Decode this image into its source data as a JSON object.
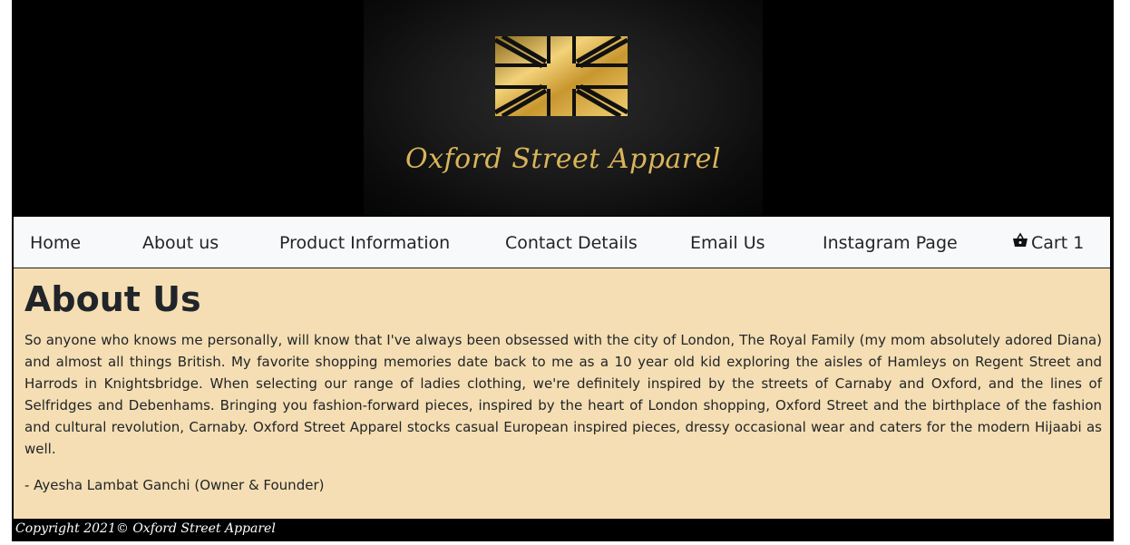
{
  "header": {
    "logo_alt": "Oxford Street Apparel",
    "brand_name": "Oxford Street Apparel"
  },
  "nav": {
    "items": [
      {
        "label": "Home"
      },
      {
        "label": "About us"
      },
      {
        "label": "Product Information"
      },
      {
        "label": "Contact Details"
      },
      {
        "label": "Email Us"
      },
      {
        "label": "Instagram Page"
      }
    ],
    "cart_label": "Cart 1"
  },
  "main": {
    "title": "About Us",
    "paragraph": "So anyone who knows me personally, will know that I've always been obsessed with the city of London, The Royal Family (my mom absolutely adored Diana) and almost all things British. My favorite shopping memories date back to me as a 10 year old kid exploring the aisles of Hamleys on Regent Street and Harrods in Knightsbridge. When selecting our range of ladies clothing, we're definitely inspired by the streets of Carnaby and Oxford, and the lines of Selfridges and Debenhams. Bringing you fashion-forward pieces, inspired by the heart of London shopping, Oxford Street and the birthplace of the fashion and cultural revolution, Carnaby. Oxford Street Apparel stocks casual European inspired pieces, dressy occasional wear and caters for the modern Hijaabi as well.",
    "signature": "- Ayesha Lambat Ganchi (Owner & Founder)"
  },
  "footer": {
    "copyright": "Copyright 2021© Oxford Street Apparel"
  },
  "colors": {
    "content_bg": "#f5deb3",
    "navbar_bg": "#f8f9fa",
    "gold": "#d9b55a"
  },
  "icons": {
    "flag": "union-jack-logo-icon",
    "cart": "shopping-basket-icon"
  }
}
